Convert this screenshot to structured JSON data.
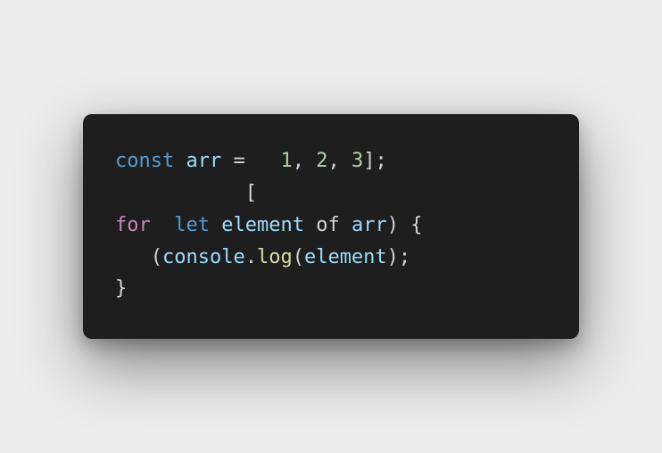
{
  "colors": {
    "page_background": "#ececec",
    "editor_background": "#1e1e1e",
    "keyword_blue": "#569cd6",
    "variable_light_blue": "#9cdcfe",
    "keyword_purple": "#c586c0",
    "number_green": "#b5cea8",
    "function_yellow": "#dcdcaa",
    "punctuation": "#d4d4d4"
  },
  "code": {
    "lines": [
      {
        "tokens": [
          {
            "text": "const",
            "color": "#569cd6"
          },
          {
            "text": " ",
            "color": "#d4d4d4"
          },
          {
            "text": "arr",
            "color": "#9cdcfe"
          },
          {
            "text": " = ",
            "color": "#d4d4d4"
          },
          {
            "text": "  ",
            "color": "#d4d4d4"
          },
          {
            "text": "1",
            "color": "#b5cea8"
          },
          {
            "text": ", ",
            "color": "#d4d4d4"
          },
          {
            "text": "2",
            "color": "#b5cea8"
          },
          {
            "text": ", ",
            "color": "#d4d4d4"
          },
          {
            "text": "3",
            "color": "#b5cea8"
          },
          {
            "text": "];",
            "color": "#d4d4d4"
          }
        ]
      },
      {
        "tokens": [
          {
            "text": "           [",
            "color": "#d4d4d4"
          }
        ]
      },
      {
        "tokens": [
          {
            "text": "for",
            "color": "#c586c0"
          },
          {
            "text": "  ",
            "color": "#d4d4d4"
          },
          {
            "text": "let",
            "color": "#569cd6"
          },
          {
            "text": " ",
            "color": "#d4d4d4"
          },
          {
            "text": "element",
            "color": "#9cdcfe"
          },
          {
            "text": " of ",
            "color": "#d4d4d4"
          },
          {
            "text": "arr",
            "color": "#9cdcfe"
          },
          {
            "text": ") {",
            "color": "#d4d4d4"
          }
        ]
      },
      {
        "tokens": [
          {
            "text": "   (",
            "color": "#d4d4d4"
          },
          {
            "text": "console",
            "color": "#9cdcfe"
          },
          {
            "text": ".",
            "color": "#d4d4d4"
          },
          {
            "text": "log",
            "color": "#dcdcaa"
          },
          {
            "text": "(",
            "color": "#d4d4d4"
          },
          {
            "text": "element",
            "color": "#9cdcfe"
          },
          {
            "text": ");",
            "color": "#d4d4d4"
          }
        ]
      },
      {
        "tokens": [
          {
            "text": "}",
            "color": "#d4d4d4"
          }
        ]
      }
    ]
  }
}
